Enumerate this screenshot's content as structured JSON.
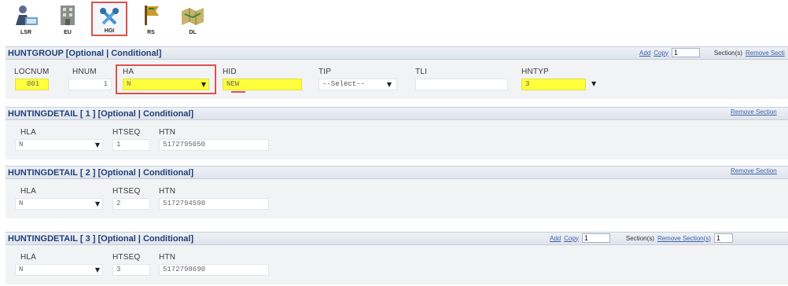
{
  "toolbar": {
    "buttons": [
      {
        "label": "LSR"
      },
      {
        "label": "EU"
      },
      {
        "label": "HGI"
      },
      {
        "label": "RS"
      },
      {
        "label": "DL"
      }
    ]
  },
  "huntgroup": {
    "title": "HUNTGROUP [Optional | Conditional]",
    "add": "Add",
    "copy": "Copy",
    "copy_count": "1",
    "sections_label": "Section(s)",
    "remove": "Remove Secti",
    "fields": {
      "locnum": {
        "label": "LOCNUM",
        "value": "001"
      },
      "hnum": {
        "label": "HNUM",
        "value": "1"
      },
      "ha": {
        "label": "HA",
        "value": "N"
      },
      "hid": {
        "label": "HID",
        "value": "NEW"
      },
      "tip": {
        "label": "TIP",
        "value": "--Select--"
      },
      "tli": {
        "label": "TLI",
        "value": ""
      },
      "hntyp": {
        "label": "HNTYP",
        "value": "3"
      }
    }
  },
  "hunting_details": [
    {
      "title": "HUNTINGDETAIL [ 1 ] [Optional | Conditional]",
      "remove": "Remove Section",
      "hla": {
        "label": "HLA",
        "value": "N"
      },
      "htseq": {
        "label": "HTSEQ",
        "value": "1"
      },
      "htn": {
        "label": "HTN",
        "value": "5172795050"
      }
    },
    {
      "title": "HUNTINGDETAIL [ 2 ] [Optional | Conditional]",
      "remove": "Remove Section",
      "hla": {
        "label": "HLA",
        "value": "N"
      },
      "htseq": {
        "label": "HTSEQ",
        "value": "2"
      },
      "htn": {
        "label": "HTN",
        "value": "5172794598"
      }
    },
    {
      "title": "HUNTINGDETAIL [ 3 ] [Optional | Conditional]",
      "add": "Add",
      "copy": "Copy",
      "copy_count": "1",
      "sections_label": "Section(s)",
      "remove": "Remove Section(s)",
      "remove_count": "1",
      "hla": {
        "label": "HLA",
        "value": "N"
      },
      "htseq": {
        "label": "HTSEQ",
        "value": "3"
      },
      "htn": {
        "label": "HTN",
        "value": "5172798690"
      }
    }
  ],
  "colors": {
    "accent": "#1f3f78",
    "highlight": "#ffff3c",
    "focus": "#d9534f",
    "link": "#3a63a8"
  }
}
